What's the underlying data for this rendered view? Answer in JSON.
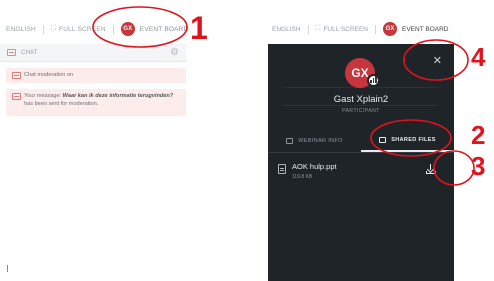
{
  "left": {
    "topbar": {
      "language": "ENGLISH",
      "fullscreen": "FULL SCREEN",
      "avatar_initials": "GX",
      "event_board": "EVENT BOARD"
    },
    "chat": {
      "title": "CHAT",
      "messages": [
        {
          "text": "Chat moderation on"
        },
        {
          "prefix": "Your message: ",
          "quote": "Waar kan ik deze informatie terugvinden?",
          "suffix": "has been sent for moderation."
        }
      ]
    }
  },
  "right": {
    "topbar": {
      "language": "ENGLISH",
      "fullscreen": "FULL SCREEN",
      "avatar_initials": "GX",
      "event_board": "EVENT BOARD"
    },
    "profile": {
      "initials": "GX",
      "name": "Gast Xplain2",
      "role": "PARTICIPANT"
    },
    "tabs": [
      {
        "label": "WEBINAR INFO"
      },
      {
        "label": "SHARED FILES"
      }
    ],
    "file": {
      "name": "AOK hulp.ppt",
      "size": "119.8 KB"
    }
  },
  "annotations": [
    "1",
    "2",
    "3",
    "4"
  ],
  "colors": {
    "accent": "#c6363c",
    "dark_panel": "#1f2428",
    "annotation": "#e0141c"
  }
}
